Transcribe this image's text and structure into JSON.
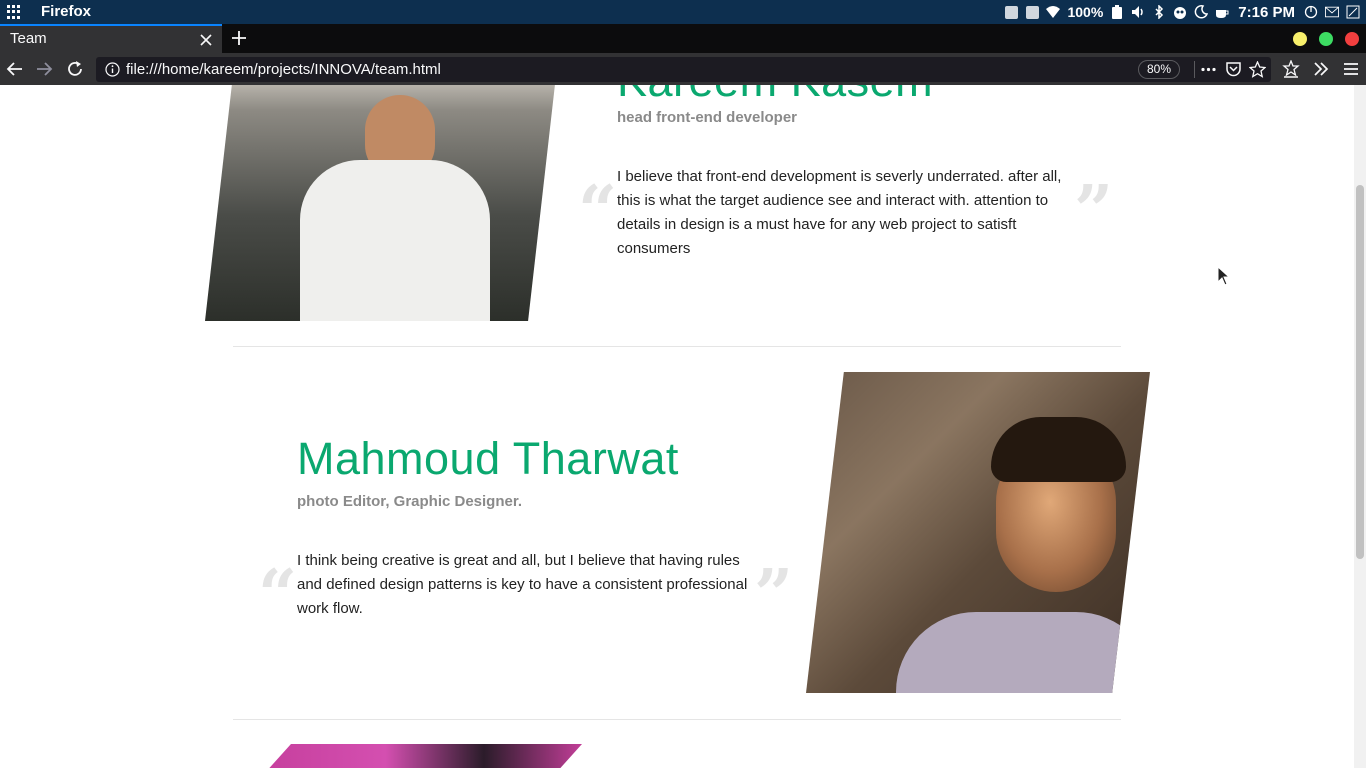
{
  "system_panel": {
    "app_name": "Firefox",
    "battery_percent": "100%",
    "clock": "7:16 PM"
  },
  "browser": {
    "tab_title": "Team",
    "url": "file:///home/kareem/projects/INNOVA/team.html",
    "zoom": "80%"
  },
  "team": {
    "members": [
      {
        "name": "Kareem Kasem",
        "role": "head front-end developer",
        "quote": "I believe that front-end development is severly underrated. after all, this is what the target audience see and interact with. attention to details in design is a must have for any web project to satisft consumers"
      },
      {
        "name": "Mahmoud Tharwat",
        "role": "photo Editor, Graphic Designer.",
        "quote": "I think being creative is great and all, but I believe that having rules and defined design patterns is key to have a consistent professional work flow."
      }
    ],
    "quote_open": "“",
    "quote_close": "”"
  },
  "colors": {
    "accent": "#0aa86f",
    "role_text": "#8a8a8a",
    "quote_mark": "#e4e4e4",
    "system_panel_bg": "#0d2f4f",
    "tab_accent": "#0a84ff"
  }
}
